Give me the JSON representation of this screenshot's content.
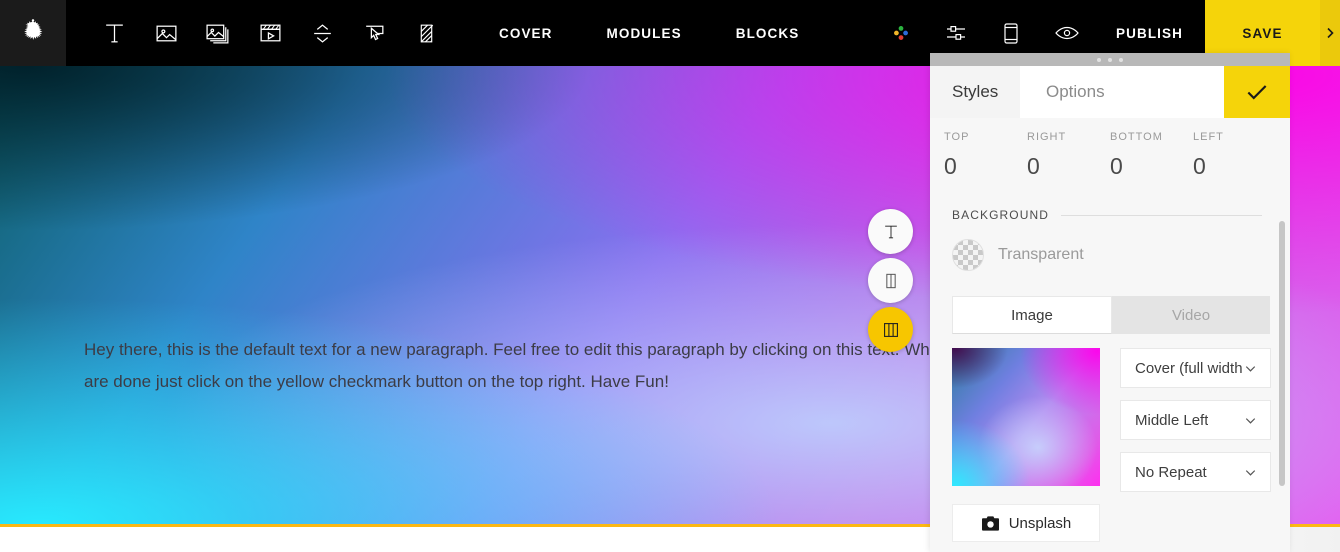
{
  "topbar": {
    "logo_icon": "eagle-crest-logo",
    "tools": [
      {
        "icon": "text-tool-icon",
        "name": "text"
      },
      {
        "icon": "image-tool-icon",
        "name": "image"
      },
      {
        "icon": "gallery-tool-icon",
        "name": "gallery"
      },
      {
        "icon": "video-tool-icon",
        "name": "video"
      },
      {
        "icon": "spacer-tool-icon",
        "name": "spacer"
      },
      {
        "icon": "button-tool-icon",
        "name": "button"
      },
      {
        "icon": "divider-tool-icon",
        "name": "divider"
      }
    ],
    "nav": [
      {
        "label": "COVER"
      },
      {
        "label": "MODULES"
      },
      {
        "label": "BLOCKS"
      }
    ],
    "right_icons": [
      {
        "icon": "color-dots-icon",
        "name": "theme-colors"
      },
      {
        "icon": "sliders-icon",
        "name": "settings"
      },
      {
        "icon": "mobile-icon",
        "name": "mobile-preview"
      },
      {
        "icon": "eye-icon",
        "name": "preview"
      }
    ],
    "publish_label": "PUBLISH",
    "save_label": "SAVE",
    "expand_icon": "chevron-right-icon"
  },
  "canvas": {
    "paragraph": "Hey there, this is the default text for a new paragraph. Feel free to edit this paragraph by clicking on this text. When you are done just click on the yellow checkmark button on the top right. Have Fun!",
    "fabs": [
      {
        "icon": "text-block-icon",
        "name": "add-text-block",
        "active": false
      },
      {
        "icon": "two-column-icon",
        "name": "two-column-layout",
        "active": false
      },
      {
        "icon": "three-column-icon",
        "name": "three-column-layout",
        "active": true
      }
    ]
  },
  "panel": {
    "tabs": {
      "styles": "Styles",
      "options": "Options"
    },
    "confirm_icon": "checkmark-icon",
    "spacing": [
      {
        "label": "TOP",
        "value": "0"
      },
      {
        "label": "RIGHT",
        "value": "0"
      },
      {
        "label": "BOTTOM",
        "value": "0"
      },
      {
        "label": "LEFT",
        "value": "0"
      }
    ],
    "background": {
      "section_title": "BACKGROUND",
      "swatch_icon": "transparent-checker-swatch",
      "swatch_label": "Transparent",
      "media_tabs": {
        "image": "Image",
        "video": "Video"
      },
      "selects": [
        {
          "value": "Cover (full width",
          "name": "background-size-select"
        },
        {
          "value": "Middle Left",
          "name": "background-position-select"
        },
        {
          "value": "No Repeat",
          "name": "background-repeat-select"
        }
      ],
      "unsplash": {
        "icon": "camera-icon",
        "label": "Unsplash"
      }
    }
  },
  "colors": {
    "accent_yellow": "#f5d40a",
    "topbar_black": "#000000",
    "panel_bg": "#f7f7f7",
    "rule_orange": "#fcb814"
  }
}
